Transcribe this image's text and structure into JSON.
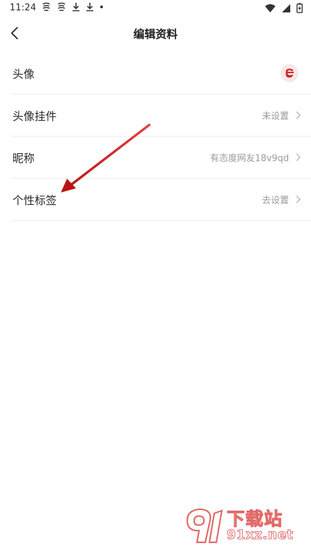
{
  "status_bar": {
    "time": "11:24"
  },
  "header": {
    "title": "编辑资料"
  },
  "rows": [
    {
      "label": "头像",
      "value": ""
    },
    {
      "label": "头像挂件",
      "value": "未设置"
    },
    {
      "label": "昵称",
      "value": "有态度网友18v9qd"
    },
    {
      "label": "个性标签",
      "value": "去设置"
    }
  ],
  "watermark": {
    "title": "下载站",
    "url": "91xz.net"
  },
  "colors": {
    "accent_red": "#d8232a",
    "arrow_red": "#c61d1d",
    "value_gray": "#9b9b9b",
    "divider": "#eeeeee"
  },
  "icons": {
    "back": "chevron-left-icon",
    "row_arrow": "chevron-right-icon",
    "avatar": "avatar-logo-icon"
  }
}
